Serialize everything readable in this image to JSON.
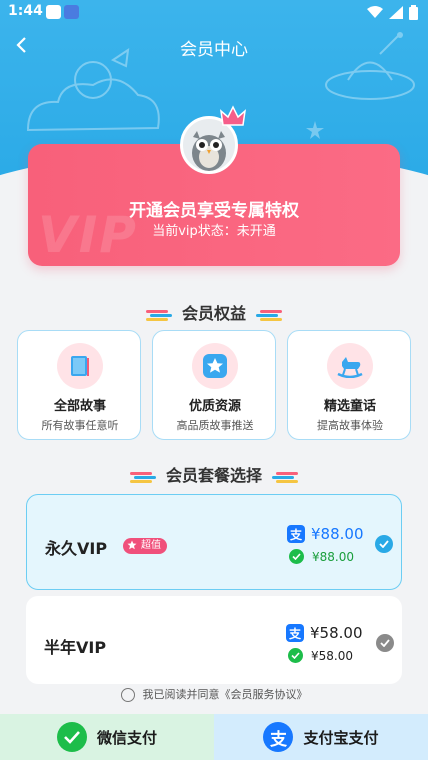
{
  "status_bar": {
    "time": "1:44"
  },
  "nav": {
    "title": "会员中心"
  },
  "vip_card": {
    "watermark": "VIP",
    "title": "开通会员享受专属特权",
    "status": "当前vip状态：未开通"
  },
  "benefits_section": {
    "title": "会员权益"
  },
  "benefits": [
    {
      "icon": "book-icon",
      "title": "全部故事",
      "subtitle": "所有故事任意听"
    },
    {
      "icon": "star-icon",
      "title": "优质资源",
      "subtitle": "高品质故事推送"
    },
    {
      "icon": "rocking-horse-icon",
      "title": "精选童话",
      "subtitle": "提高故事体验"
    }
  ],
  "packages_section": {
    "title": "会员套餐选择"
  },
  "packages": [
    {
      "name": "永久VIP",
      "badge": "超值",
      "alipay_price": "¥88.00",
      "wechat_price": "¥88.00",
      "selected": true
    },
    {
      "name": "半年VIP",
      "alipay_price": "¥58.00",
      "wechat_price": "¥58.00",
      "selected": false
    }
  ],
  "agreement": {
    "text": "我已阅读并同意《会员服务协议》",
    "checked": false
  },
  "pay": {
    "wechat_label": "微信支付",
    "alipay_label": "支付宝支付"
  },
  "colors": {
    "brand_blue": "#29a9e6",
    "vip_pink": "#f8607a",
    "alipay_blue": "#1778ff",
    "wechat_green": "#1dbd4a"
  }
}
